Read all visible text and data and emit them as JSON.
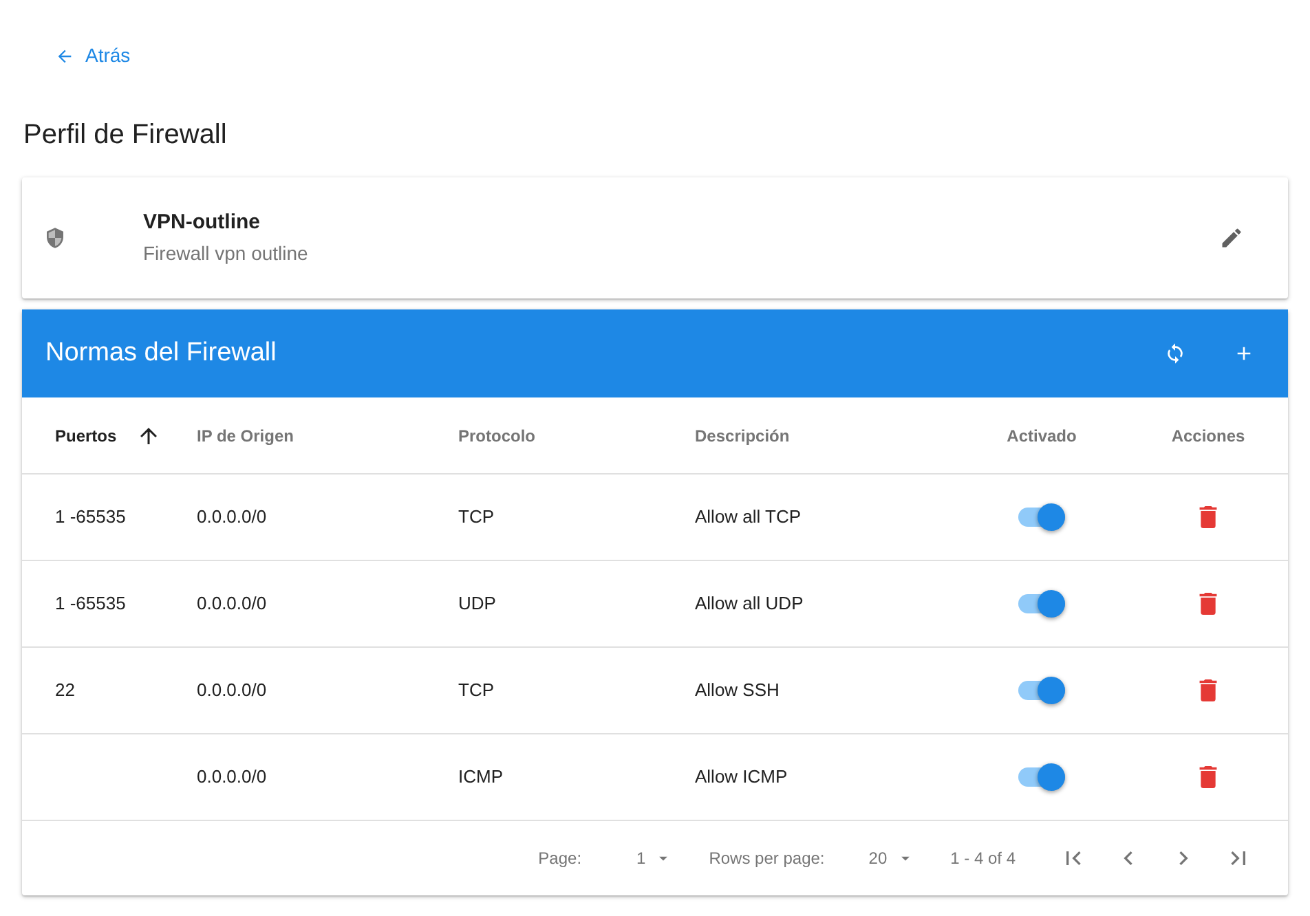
{
  "back_link": {
    "label": "Atrás"
  },
  "page_title": "Perfil de Firewall",
  "profile": {
    "name": "VPN-outline",
    "description": "Firewall vpn outline"
  },
  "rules_panel": {
    "title": "Normas del Firewall"
  },
  "table": {
    "columns": [
      {
        "label": "Puertos",
        "sorted": true
      },
      {
        "label": "IP de Origen",
        "sorted": false
      },
      {
        "label": "Protocolo",
        "sorted": false
      },
      {
        "label": "Descripción",
        "sorted": false
      },
      {
        "label": "Activado",
        "sorted": false
      },
      {
        "label": "Acciones",
        "sorted": false
      }
    ],
    "rows": [
      {
        "ports": "1 -65535",
        "source_ip": "0.0.0.0/0",
        "protocol": "TCP",
        "description": "Allow all TCP",
        "on": true
      },
      {
        "ports": "1 -65535",
        "source_ip": "0.0.0.0/0",
        "protocol": "UDP",
        "description": "Allow all UDP",
        "on": true
      },
      {
        "ports": "22",
        "source_ip": "0.0.0.0/0",
        "protocol": "TCP",
        "description": "Allow SSH",
        "on": true
      },
      {
        "source_ip": "0.0.0.0/0",
        "protocol": "ICMP",
        "description": "Allow ICMP",
        "on": true
      }
    ]
  },
  "pagination": {
    "page_label": "Page:",
    "page": "1",
    "rows_label": "Rows per page:",
    "rows_per_page": "20",
    "range": "1 - 4 of 4"
  }
}
